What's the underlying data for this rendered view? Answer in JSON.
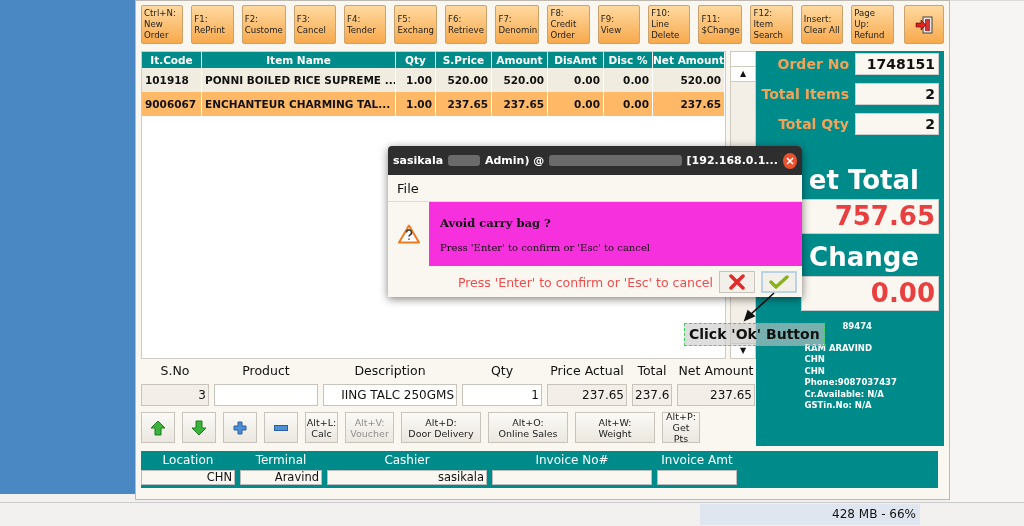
{
  "toolbar": [
    {
      "kind": "text",
      "lines": [
        "Ctrl+N:",
        "New",
        "Order"
      ]
    },
    {
      "kind": "text",
      "lines": [
        "F1:",
        "RePrint"
      ]
    },
    {
      "kind": "text",
      "lines": [
        "F2:",
        "Custome"
      ]
    },
    {
      "kind": "text",
      "lines": [
        "F3:",
        "Cancel"
      ]
    },
    {
      "kind": "text",
      "lines": [
        "F4:",
        "Tender"
      ]
    },
    {
      "kind": "text",
      "lines": [
        "F5:",
        "Exchang"
      ]
    },
    {
      "kind": "text",
      "lines": [
        "F6:",
        "Retrieve"
      ]
    },
    {
      "kind": "text",
      "lines": [
        "F7:",
        "Denomin"
      ]
    },
    {
      "kind": "text",
      "lines": [
        "F8:",
        "Credit",
        "Order"
      ]
    },
    {
      "kind": "text",
      "lines": [
        "F9:",
        "View"
      ]
    },
    {
      "kind": "text",
      "lines": [
        "F10:",
        "Line",
        "Delete"
      ]
    },
    {
      "kind": "text",
      "lines": [
        "F11:",
        "$Change"
      ]
    },
    {
      "kind": "text",
      "lines": [
        "F12:",
        "Item",
        "Search"
      ]
    },
    {
      "kind": "text",
      "lines": [
        "Insert:",
        "Clear All"
      ]
    },
    {
      "kind": "text",
      "lines": [
        "Page",
        "Up:",
        "Refund"
      ]
    },
    {
      "kind": "exit"
    }
  ],
  "table": {
    "columns": [
      "It.Code",
      "Item Name",
      "Qty",
      "S.Price",
      "Amount",
      "DisAmt",
      "Disc %",
      "Net Amount"
    ],
    "rows": [
      {
        "cells": [
          "101918",
          "PONNI BOILED RICE SUPREME ...",
          "1.00",
          "520.00",
          "520.00",
          "0.00",
          "0.00",
          "520.00"
        ],
        "selected": false
      },
      {
        "cells": [
          "9006067",
          "ENCHANTEUR CHARMING TAL...",
          "1.00",
          "237.65",
          "237.65",
          "0.00",
          "0.00",
          "237.65"
        ],
        "selected": true
      }
    ]
  },
  "summary": {
    "fields": [
      {
        "label": "Order No",
        "value": "1748151"
      },
      {
        "label": "Total Items",
        "value": "2"
      },
      {
        "label": "Total Qty",
        "value": "2"
      }
    ],
    "net_total_label": "et Total",
    "net_total": "757.65",
    "change_label": "Change",
    "change": "0.00",
    "customer": [
      "89474",
      "RAM ARAVIND",
      "CHN",
      "CHN",
      "Phone:9087037437",
      "Cr.Available: N/A",
      "GSTin.No: N/A"
    ]
  },
  "entry": [
    {
      "label": "S.No",
      "value": "3"
    },
    {
      "label": "Product"
    },
    {
      "label": "Description",
      "value": "IING TALC 250GMS"
    },
    {
      "label": "Qty",
      "value": "1"
    },
    {
      "label": "Price Actual",
      "value": "237.65"
    },
    {
      "label": "Total",
      "value": "237.6"
    },
    {
      "label": "Net Amount",
      "value": "237.65"
    }
  ],
  "actions": [
    {
      "kind": "up"
    },
    {
      "kind": "down"
    },
    {
      "kind": "plus"
    },
    {
      "kind": "minus"
    },
    {
      "kind": "text",
      "lines": [
        "Alt+L:",
        "Calc"
      ],
      "disabled": false
    },
    {
      "kind": "text",
      "lines": [
        "Alt+V:",
        "Voucher"
      ],
      "disabled": true
    },
    {
      "kind": "text",
      "lines": [
        "Alt+D:",
        "Door Delivery"
      ],
      "disabled": false
    },
    {
      "kind": "text",
      "lines": [
        "Alt+O:",
        "Online Sales"
      ],
      "disabled": false
    },
    {
      "kind": "text",
      "lines": [
        "Alt+W:",
        "Weight"
      ],
      "disabled": false
    },
    {
      "kind": "text",
      "lines": [
        "Alt+P:",
        "Get",
        "Pts"
      ],
      "disabled": false
    }
  ],
  "footer": [
    {
      "label": "Location",
      "value": "CHN"
    },
    {
      "label": "Terminal",
      "value": "Aravind"
    },
    {
      "label": "Cashier",
      "value": "sasikala"
    },
    {
      "label": "Invoice No#"
    },
    {
      "label": "Invoice Amt"
    }
  ],
  "dialog": {
    "title_parts": [
      "sasikala",
      "Admin) @",
      "[192.168.0.1..."
    ],
    "menu": "File",
    "question": "Avoid carry bag ?",
    "message": "Press 'Enter' to confirm or 'Esc' to cancel",
    "hint": "Press 'Enter' to confirm or 'Esc' to cancel"
  },
  "scroll_arrows": [
    "▲",
    "▼"
  ],
  "annotation": "Click 'Ok' Button",
  "status": "428 MB - 66%"
}
